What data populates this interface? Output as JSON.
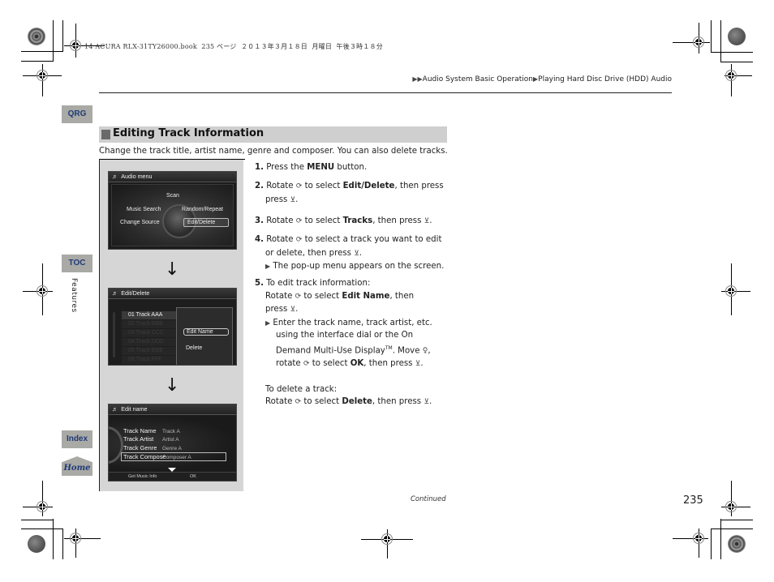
{
  "print_header": "14 ACURA RLX-31TY26000.book  235 ページ  ２０１３年３月１８日  月曜日  午後３時１８分",
  "breadcrumb": {
    "items": [
      "Audio System Basic Operation",
      "Playing Hard Disc Drive (HDD) Audio"
    ],
    "prefix_icon": "double-arrow-icon",
    "separator_icon": "arrow-icon"
  },
  "side_tabs": {
    "qrg": "QRG",
    "toc": "TOC",
    "chapter": "Features",
    "index": "Index",
    "home": "Home"
  },
  "section": {
    "title": "Editing Track Information",
    "intro": "Change the track title, artist name, genre and composer. You can also delete tracks."
  },
  "screens": {
    "audio_menu": {
      "title": "Audio menu",
      "items": [
        "Scan",
        "Music Search",
        "Random/Repeat",
        "Change Source",
        "Edit/Delete"
      ],
      "selected": "Edit/Delete"
    },
    "edit_delete": {
      "title": "Edit/Delete",
      "tracks": [
        "01 Track AAA",
        "02 Track BBB",
        "03 Track CCC",
        "04 Track DDD",
        "05 Track EEE",
        "06 Track FFF"
      ],
      "popup_items": [
        "Edit Name",
        "Delete"
      ],
      "selected": "Edit Name"
    },
    "edit_name": {
      "title": "Edit name",
      "rows": [
        {
          "label": "Track Name",
          "value": "Track A"
        },
        {
          "label": "Track Artist",
          "value": "Artist A"
        },
        {
          "label": "Track Genre",
          "value": "Genre A"
        },
        {
          "label": "Track Compose",
          "value": "Composer A"
        }
      ],
      "footer_left": "Get Music Info",
      "footer_right": "OK"
    }
  },
  "steps": {
    "s1": {
      "num": "1.",
      "pre": "Press the ",
      "bold": "MENU",
      "post": " button."
    },
    "s2": {
      "num": "2.",
      "pre": "Rotate ",
      "mid": " to select ",
      "bold": "Edit/Delete",
      "post": ", then press",
      "line2": "press "
    },
    "s3": {
      "num": "3.",
      "pre": "Rotate ",
      "mid": " to select ",
      "bold": "Tracks",
      "post": ", then press "
    },
    "s4": {
      "num": "4.",
      "pre": "Rotate ",
      "mid": " to select a track you want to edit",
      "line2": "or delete, then press ",
      "note": "The pop-up menu appears on the screen."
    },
    "s5": {
      "num": "5.",
      "line1": "To edit track information:",
      "line2_pre": "Rotate ",
      "line2_mid": " to select ",
      "line2_bold": "Edit Name",
      "line2_post": ", then",
      "line3": "press ",
      "note1": "Enter the track name, track artist, etc.",
      "note2": "using the interface dial or the On",
      "note3_pre": "Demand Multi-Use Display",
      "note3_tm": "TM",
      "note3_post": ". Move ",
      "note4_pre": "rotate ",
      "note4_mid": " to select ",
      "note4_bold": "OK",
      "note4_post": ", then press ",
      "del1": "To delete a track:",
      "del2_pre": "Rotate ",
      "del2_mid": " to select ",
      "del2_bold": "Delete",
      "del2_post": ", then press "
    }
  },
  "icons": {
    "rotate": "⟳",
    "press": "⊻",
    "move": "♀",
    "arrow": "▶",
    "down_arrow": "↓",
    "note": "♬"
  },
  "footer": {
    "continued": "Continued",
    "page": "235"
  }
}
